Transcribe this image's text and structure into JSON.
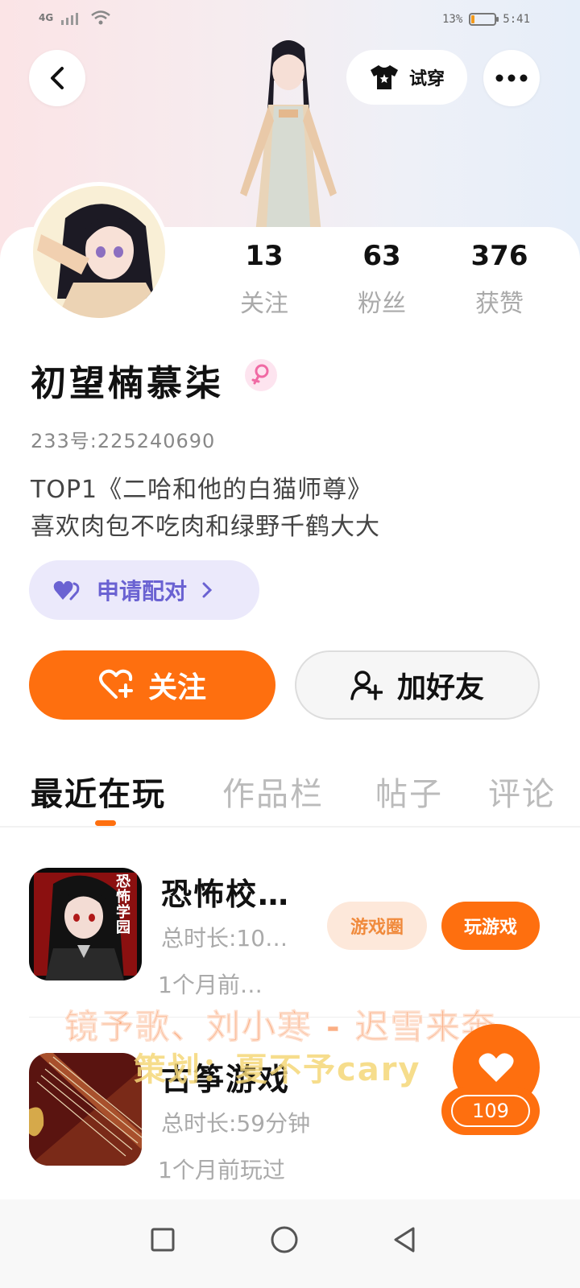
{
  "status_bar": {
    "network": "4G",
    "battery": "13%",
    "battery_level": 0.13,
    "time": "5:41"
  },
  "header": {
    "try_on_label": "试穿"
  },
  "stats": [
    {
      "value": "13",
      "label": "关注"
    },
    {
      "value": "63",
      "label": "粉丝"
    },
    {
      "value": "376",
      "label": "获赞"
    }
  ],
  "profile": {
    "nickname": "初望楠慕柒",
    "uid": "233号:225240690",
    "bio_line1": "TOP1《二哈和他的白猫师尊》",
    "bio_line2": "喜欢肉包不吃肉和绿野千鹤大大",
    "pair_label": "申请配对"
  },
  "actions": {
    "follow_label": "关注",
    "add_friend_label": "加好友"
  },
  "tabs": [
    "最近在玩",
    "作品栏",
    "帖子",
    "评论"
  ],
  "games": [
    {
      "title": "恐怖校…",
      "duration": "总时长:10…",
      "last_played": "1个月前…",
      "circle_label": "游戏圈",
      "play_label": "玩游戏",
      "icon_text": "恐怖学园"
    },
    {
      "title": "古筝游戏",
      "duration": "总时长:59分钟",
      "last_played": "1个月前玩过"
    }
  ],
  "overlay": {
    "lyrics": "镜予歌、刘小寒 - 迟雪来奔",
    "credit": "策划：夏不予cary"
  },
  "like": {
    "count": "109"
  },
  "colors": {
    "accent": "#fe6f0f",
    "pair_bg": "#ebe9fb",
    "pair_text": "#6a62d2",
    "gender": "#f06aa4"
  }
}
